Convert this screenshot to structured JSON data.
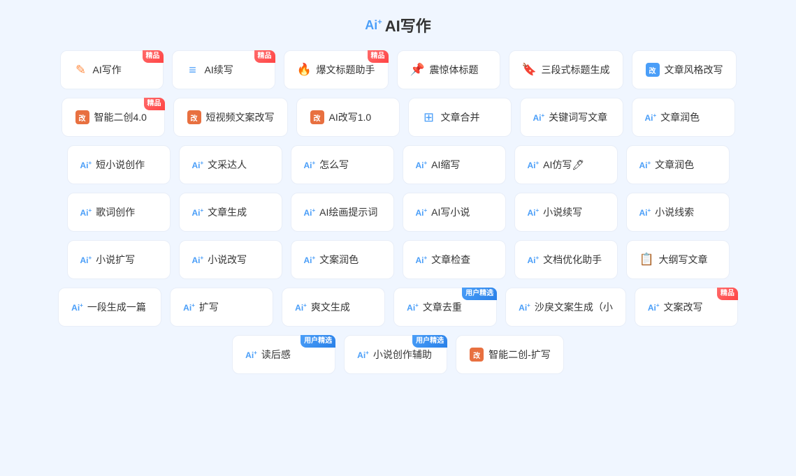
{
  "page": {
    "title": "AI写作",
    "ai_prefix": "Ai"
  },
  "rows": [
    [
      {
        "id": "ai-writing",
        "icon": "✎",
        "icon_type": "circle-orange",
        "prefix": "",
        "name": "AI写作",
        "badge": "精品",
        "badge_type": "hot"
      },
      {
        "id": "ai-continue",
        "icon": "≡",
        "icon_type": "lines-blue",
        "prefix": "",
        "name": "AI续写",
        "badge": "精品",
        "badge_type": "hot"
      },
      {
        "id": "boom-title",
        "icon": "🔥",
        "icon_type": "emoji",
        "prefix": "",
        "name": "爆文标题助手",
        "badge": "精品",
        "badge_type": "hot"
      },
      {
        "id": "shock-title",
        "icon": "📌",
        "icon_type": "emoji",
        "prefix": "",
        "name": "震惊体标题",
        "badge": "",
        "badge_type": ""
      },
      {
        "id": "three-title",
        "icon": "🔖",
        "icon_type": "emoji",
        "prefix": "",
        "name": "三段式标题生成",
        "badge": "",
        "badge_type": ""
      },
      {
        "id": "style-rewrite",
        "icon": "改",
        "icon_type": "square-blue",
        "prefix": "",
        "name": "文章风格改写",
        "badge": "",
        "badge_type": ""
      }
    ],
    [
      {
        "id": "smart-create",
        "icon": "改",
        "icon_type": "square-orange",
        "prefix": "",
        "name": "智能二创4.0",
        "badge": "精品",
        "badge_type": "hot"
      },
      {
        "id": "video-rewrite",
        "icon": "改",
        "icon_type": "square-orange",
        "prefix": "",
        "name": "短视频文案改写",
        "badge": "",
        "badge_type": ""
      },
      {
        "id": "ai-rewrite",
        "icon": "改",
        "icon_type": "square-orange",
        "prefix": "",
        "name": "AI改写1.0",
        "badge": "",
        "badge_type": ""
      },
      {
        "id": "article-merge",
        "icon": "⊞",
        "icon_type": "merge",
        "prefix": "",
        "name": "文章合并",
        "badge": "",
        "badge_type": ""
      },
      {
        "id": "keyword-write",
        "icon": "ai",
        "icon_type": "ai-blue",
        "prefix": "Ai+",
        "name": "关键词写文章",
        "badge": "",
        "badge_type": ""
      },
      {
        "id": "article-polish1",
        "icon": "ai",
        "icon_type": "ai-blue",
        "prefix": "Ai+",
        "name": "文章润色",
        "badge": "",
        "badge_type": ""
      }
    ],
    [
      {
        "id": "short-novel",
        "icon": "ai",
        "icon_type": "ai-blue",
        "prefix": "Ai+",
        "name": "短小说创作",
        "badge": "",
        "badge_type": ""
      },
      {
        "id": "wen-cai",
        "icon": "ai",
        "icon_type": "ai-blue",
        "prefix": "Ai+",
        "name": "文采达人",
        "badge": "",
        "badge_type": ""
      },
      {
        "id": "how-write",
        "icon": "ai",
        "icon_type": "ai-blue",
        "prefix": "Ai+",
        "name": "怎么写",
        "badge": "",
        "badge_type": ""
      },
      {
        "id": "ai-shorten",
        "icon": "ai",
        "icon_type": "ai-blue",
        "prefix": "Ai+",
        "name": "AI缩写",
        "badge": "",
        "badge_type": ""
      },
      {
        "id": "ai-imitate",
        "icon": "ai",
        "icon_type": "ai-blue",
        "prefix": "Ai+",
        "name": "AI仿写🖊",
        "badge": "",
        "badge_type": ""
      },
      {
        "id": "article-polish2",
        "icon": "ai",
        "icon_type": "ai-blue",
        "prefix": "Ai+",
        "name": "文章润色",
        "badge": "",
        "badge_type": ""
      }
    ],
    [
      {
        "id": "lyric-create",
        "icon": "ai",
        "icon_type": "ai-blue",
        "prefix": "Ai+",
        "name": "歌词创作",
        "badge": "",
        "badge_type": ""
      },
      {
        "id": "article-gen",
        "icon": "ai",
        "icon_type": "ai-blue",
        "prefix": "Ai+",
        "name": "文章生成",
        "badge": "",
        "badge_type": ""
      },
      {
        "id": "ai-draw-prompt",
        "icon": "ai",
        "icon_type": "ai-blue",
        "prefix": "Ai+",
        "name": "AI绘画提示词",
        "badge": "",
        "badge_type": ""
      },
      {
        "id": "ai-novel-write",
        "icon": "ai",
        "icon_type": "ai-blue",
        "prefix": "Ai+",
        "name": "AI写小说",
        "badge": "",
        "badge_type": ""
      },
      {
        "id": "novel-continue",
        "icon": "ai",
        "icon_type": "ai-blue",
        "prefix": "Ai+",
        "name": "小说续写",
        "badge": "",
        "badge_type": ""
      },
      {
        "id": "novel-clue",
        "icon": "ai",
        "icon_type": "ai-blue",
        "prefix": "Ai+",
        "name": "小说线索",
        "badge": "",
        "badge_type": ""
      }
    ],
    [
      {
        "id": "novel-expand",
        "icon": "ai",
        "icon_type": "ai-blue",
        "prefix": "Ai+",
        "name": "小说扩写",
        "badge": "",
        "badge_type": ""
      },
      {
        "id": "novel-rewrite",
        "icon": "ai",
        "icon_type": "ai-blue",
        "prefix": "Ai+",
        "name": "小说改写",
        "badge": "",
        "badge_type": ""
      },
      {
        "id": "copy-polish",
        "icon": "ai",
        "icon_type": "ai-blue",
        "prefix": "Ai+",
        "name": "文案润色",
        "badge": "",
        "badge_type": ""
      },
      {
        "id": "article-check",
        "icon": "ai",
        "icon_type": "ai-blue",
        "prefix": "Ai+",
        "name": "文章检查",
        "badge": "",
        "badge_type": ""
      },
      {
        "id": "doc-optimize",
        "icon": "ai",
        "icon_type": "ai-blue",
        "prefix": "Ai+",
        "name": "文档优化助手",
        "badge": "",
        "badge_type": ""
      },
      {
        "id": "outline-write",
        "icon": "📋",
        "icon_type": "outline",
        "prefix": "",
        "name": "大纲写文章",
        "badge": "",
        "badge_type": ""
      }
    ],
    [
      {
        "id": "one-para",
        "icon": "ai",
        "icon_type": "ai-blue",
        "prefix": "Ai+",
        "name": "一段生成一篇",
        "badge": "",
        "badge_type": ""
      },
      {
        "id": "expand",
        "icon": "ai",
        "icon_type": "ai-blue",
        "prefix": "Ai+",
        "name": "扩写",
        "badge": "",
        "badge_type": ""
      },
      {
        "id": "cool-gen",
        "icon": "ai",
        "icon_type": "ai-blue",
        "prefix": "Ai+",
        "name": "爽文生成",
        "badge": "",
        "badge_type": ""
      },
      {
        "id": "article-dedup",
        "icon": "ai",
        "icon_type": "ai-blue",
        "prefix": "Ai+",
        "name": "文章去重",
        "badge": "用户精选",
        "badge_type": "user"
      },
      {
        "id": "sha-li-copy",
        "icon": "ai",
        "icon_type": "ai-blue",
        "prefix": "Ai+",
        "name": "沙戾文案生成（小",
        "badge": "",
        "badge_type": ""
      },
      {
        "id": "copy-rewrite",
        "icon": "ai",
        "icon_type": "ai-blue",
        "prefix": "Ai+",
        "name": "文案改写",
        "badge": "精品",
        "badge_type": "hot"
      }
    ],
    [
      {
        "id": "read-feeling",
        "icon": "ai",
        "icon_type": "ai-blue",
        "prefix": "Ai+",
        "name": "读后感",
        "badge": "用户精选",
        "badge_type": "user"
      },
      {
        "id": "novel-assist",
        "icon": "ai",
        "icon_type": "ai-blue",
        "prefix": "Ai+",
        "name": "小说创作辅助",
        "badge": "用户精选",
        "badge_type": "user"
      },
      {
        "id": "smart-expand",
        "icon": "改",
        "icon_type": "square-orange",
        "prefix": "",
        "name": "智能二创-扩写",
        "badge": "",
        "badge_type": ""
      }
    ]
  ]
}
